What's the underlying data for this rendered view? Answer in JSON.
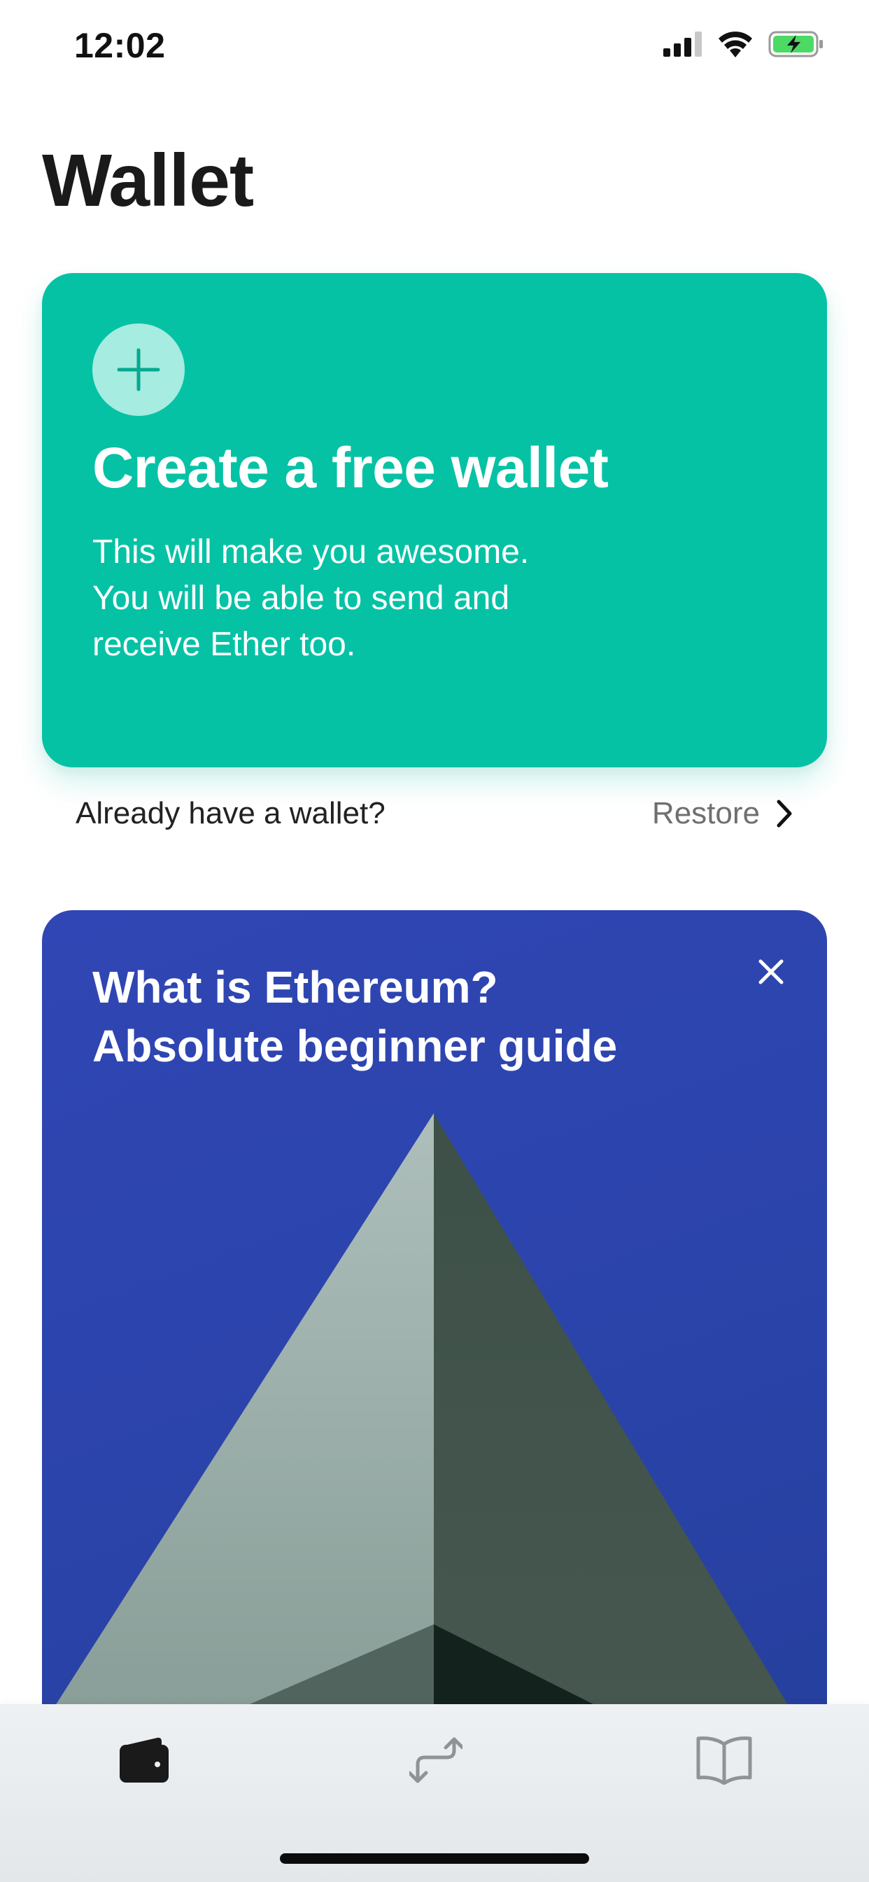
{
  "status_bar": {
    "time": "12:02",
    "icons": [
      "cellular-signal-icon",
      "wifi-icon",
      "battery-charging-icon"
    ]
  },
  "page": {
    "title": "Wallet"
  },
  "create_card": {
    "icon": "plus-icon",
    "title": "Create a free wallet",
    "description_lines": [
      "This will make you awesome.",
      "You will be able to send and",
      "receive Ether too."
    ],
    "color": "#06c2a5"
  },
  "restore": {
    "question": "Already have a wallet?",
    "link_label": "Restore",
    "icon": "chevron-right-icon"
  },
  "guide_card": {
    "title_lines": [
      "What is Ethereum?",
      "Absolute beginner guide"
    ],
    "close_icon": "close-icon",
    "illustration": "ethereum-pyramid-illustration",
    "color": "#2b44ab"
  },
  "tab_bar": {
    "tabs": [
      {
        "id": "wallet",
        "icon": "wallet-icon",
        "selected": true
      },
      {
        "id": "transfer",
        "icon": "transfer-arrows-icon",
        "selected": false
      },
      {
        "id": "learn",
        "icon": "book-icon",
        "selected": false
      }
    ]
  }
}
